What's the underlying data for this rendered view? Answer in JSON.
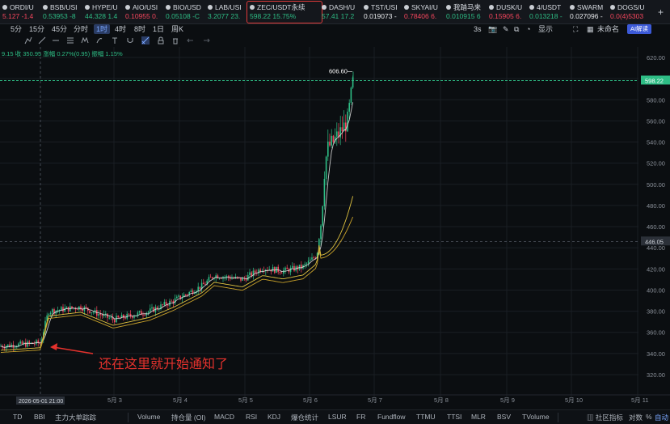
{
  "tickers": [
    {
      "name": "ORDI/U",
      "price": "5.127",
      "change": "-1.4",
      "dir": "down"
    },
    {
      "name": "BSB/USI",
      "price": "0.53953",
      "change": "-8",
      "dir": "up"
    },
    {
      "name": "HYPE/U",
      "price": "44.328",
      "change": "1.4",
      "dir": "up"
    },
    {
      "name": "AIO/USI",
      "price": "0.10955",
      "change": "0.",
      "dir": "down"
    },
    {
      "name": "BIO/USD",
      "price": "0.05108",
      "change": "-C",
      "dir": "up"
    },
    {
      "name": "LAB/USI",
      "price": "3.2077",
      "change": "23.",
      "dir": "up"
    },
    {
      "name": "ZEC/USDT永续",
      "price": "598.22",
      "change": "15.75%",
      "dir": "up",
      "selected": true
    },
    {
      "name": "DASH/U",
      "price": "57.41",
      "change": "17.2",
      "dir": "up"
    },
    {
      "name": "TST/USI",
      "price": "0.019073",
      "change": "-",
      "dir": "neutral"
    },
    {
      "name": "SKYAI/U",
      "price": "0.78406",
      "change": "6.",
      "dir": "down"
    },
    {
      "name": "我踏马来",
      "price": "0.010915",
      "change": "6",
      "dir": "up"
    },
    {
      "name": "DUSK/U",
      "price": "0.15905",
      "change": "6.",
      "dir": "down"
    },
    {
      "name": "4/USDT",
      "price": "0.013218",
      "change": "-",
      "dir": "up"
    },
    {
      "name": "SWARM",
      "price": "0.027096",
      "change": "-",
      "dir": "neutral"
    },
    {
      "name": "DOGS/U",
      "price": "0.0(4)5303",
      "change": "",
      "dir": "down"
    }
  ],
  "add_symbol": "+",
  "timeframes": [
    "5分",
    "15分",
    "45分",
    "分时",
    "1时",
    "4时",
    "8时",
    "1日",
    "周K"
  ],
  "active_timeframe": "1时",
  "toolbar_right": {
    "seconds": "3s",
    "display": "显示",
    "layout": "未命名",
    "ai": "AI解读"
  },
  "info_line": "9.15  收 350.95  涨幅 0.27%(0.95)  振幅 1.15%",
  "chart": {
    "annotation": "还在这里就开始通知了",
    "high_label": "606.60",
    "current_price": "598.22",
    "hline_price": "446.05",
    "x_cursor_label": "2026-05-01 21:00",
    "y_ticks": [
      "620.00",
      "600.00",
      "580.00",
      "560.00",
      "540.00",
      "520.00",
      "500.00",
      "480.00",
      "460.00",
      "440.00",
      "420.00",
      "400.00",
      "380.00",
      "360.00",
      "340.00",
      "320.00"
    ],
    "x_ticks": [
      "5月 3",
      "5月 4",
      "5月 5",
      "5月 6",
      "5月 7",
      "5月 8",
      "5月 9",
      "5月 10",
      "5月 11"
    ],
    "colors": {
      "up": "#2ebd85",
      "down": "#f6465d",
      "ma_white": "#e8e8e8",
      "ma_yellow": "#e0c341",
      "ma_gold": "#c9a22a",
      "arrow": "#e5322d",
      "grid": "#1a1e24"
    }
  },
  "indicators": [
    "TD",
    "BBI",
    "主力大单踪踪",
    "Volume",
    "持仓量 (OI)",
    "MACD",
    "RSI",
    "KDJ",
    "爆仓统计",
    "LSUR",
    "FR",
    "Fundflow",
    "TTMU",
    "TTSI",
    "MLR",
    "BSV",
    "TVolume"
  ],
  "indicator_right": {
    "community": "社区指标",
    "compare": "对数",
    "percent": "%",
    "auto": "自动"
  }
}
